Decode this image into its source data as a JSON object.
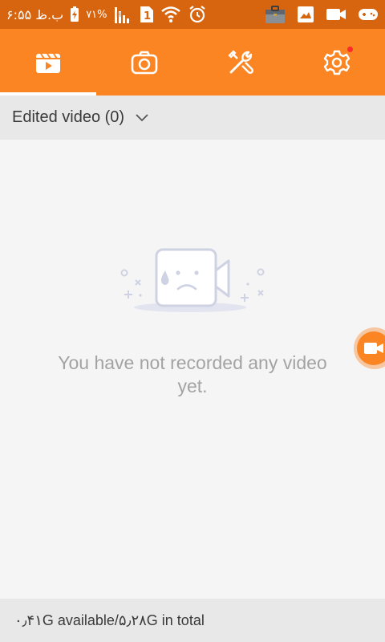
{
  "status_bar": {
    "time": "ب.ظ ۶:۵۵",
    "battery_percent": "۷۱%",
    "sim_label": "1",
    "icons": [
      "charging-icon",
      "signal-icon",
      "sim-icon",
      "wifi-icon",
      "alarm-icon",
      "briefcase-icon",
      "gallery-icon",
      "video-icon",
      "game-icon"
    ]
  },
  "nav": {
    "tabs": [
      {
        "name": "videos",
        "icon": "video-library-icon",
        "active": true
      },
      {
        "name": "screenshots",
        "icon": "camera-icon",
        "active": false
      },
      {
        "name": "tools",
        "icon": "tools-icon",
        "active": false
      },
      {
        "name": "settings",
        "icon": "gear-icon",
        "active": false,
        "has_notification": true
      }
    ],
    "accent_color": "#fb8523"
  },
  "filter": {
    "label": "Edited video (0)"
  },
  "empty_state": {
    "message": "You have not recorded any video yet."
  },
  "storage": {
    "text": "۰٫۴۱G available/۵٫۲۸G in total"
  }
}
